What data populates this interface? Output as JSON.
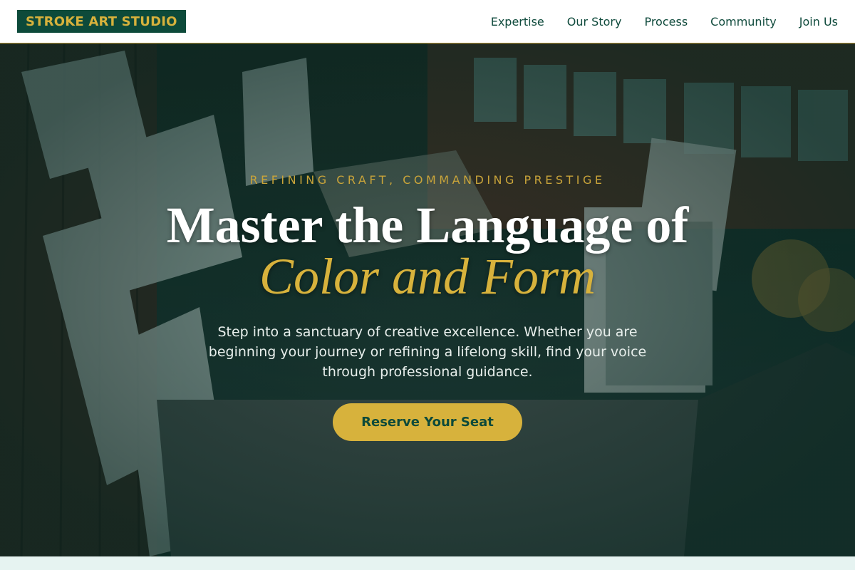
{
  "header": {
    "logo": "STROKE ART STUDIO",
    "nav": [
      {
        "label": "Expertise"
      },
      {
        "label": "Our Story"
      },
      {
        "label": "Process"
      },
      {
        "label": "Community"
      },
      {
        "label": "Join Us"
      }
    ]
  },
  "hero": {
    "eyebrow": "REFINING CRAFT, COMMANDING PRESTIGE",
    "title_line1": "Master the Language of",
    "title_line2": "Color and Form",
    "subtitle": "Step into a sanctuary of creative excellence. Whether you are beginning your journey or refining a lifelong skill, find your voice through professional guidance.",
    "cta_label": "Reserve Your Seat",
    "background_image": "art-studio-photo"
  },
  "colors": {
    "primary": "#0d4a3a",
    "accent": "#d7b23c",
    "band": "#e6f3f1"
  }
}
